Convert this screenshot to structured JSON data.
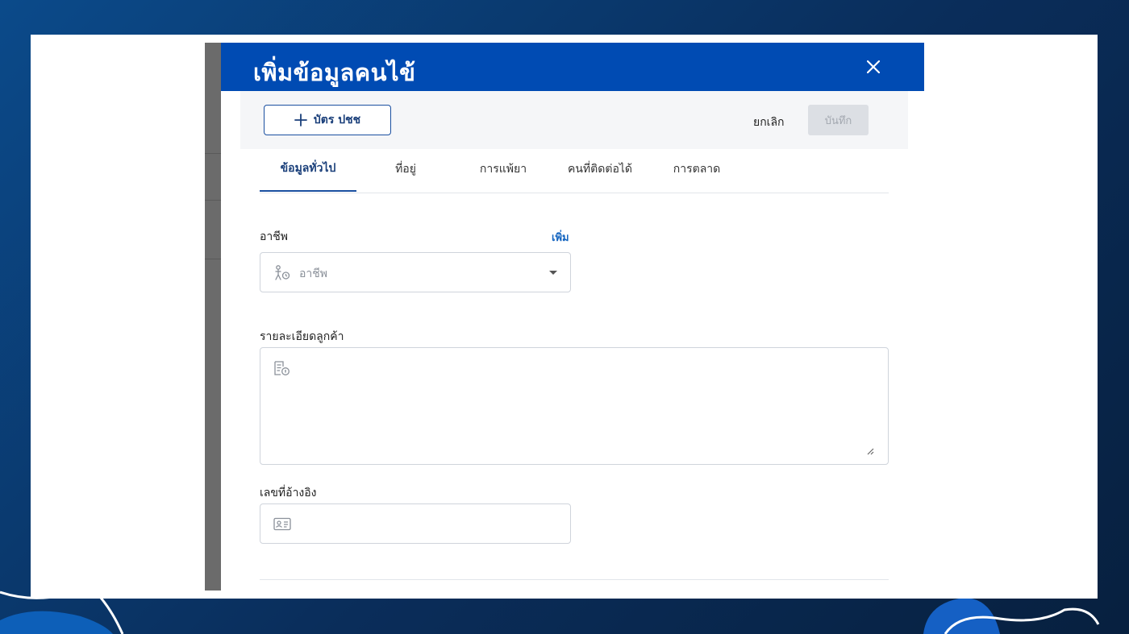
{
  "modal": {
    "title": "เพิ่มข้อมูลคนไข้",
    "close_icon": "close-icon"
  },
  "toolbar": {
    "id_card_label": "บัตร ปชช",
    "cancel_label": "ยกเลิก",
    "save_label": "บันทึก"
  },
  "tabs": [
    {
      "label": "ข้อมูลทั่วไป",
      "active": true
    },
    {
      "label": "ที่อยู่",
      "active": false
    },
    {
      "label": "การแพ้ยา",
      "active": false
    },
    {
      "label": "คนที่ติดต่อได้",
      "active": false
    },
    {
      "label": "การตลาด",
      "active": false
    }
  ],
  "form": {
    "occupation": {
      "label": "อาชีพ",
      "add_label": "เพิ่ม",
      "placeholder": "อาชีพ",
      "icon": "person-occupation-icon"
    },
    "customer_details": {
      "label": "รายละเอียดลูกค้า",
      "value": "",
      "icon": "document-info-icon"
    },
    "reference_number": {
      "label": "เลขที่อ้างอิง",
      "value": "",
      "icon": "id-card-icon"
    }
  },
  "colors": {
    "header": "#004bb3",
    "accent": "#1a4fa0",
    "link": "#1565c0",
    "background": "#0a2d5a"
  }
}
